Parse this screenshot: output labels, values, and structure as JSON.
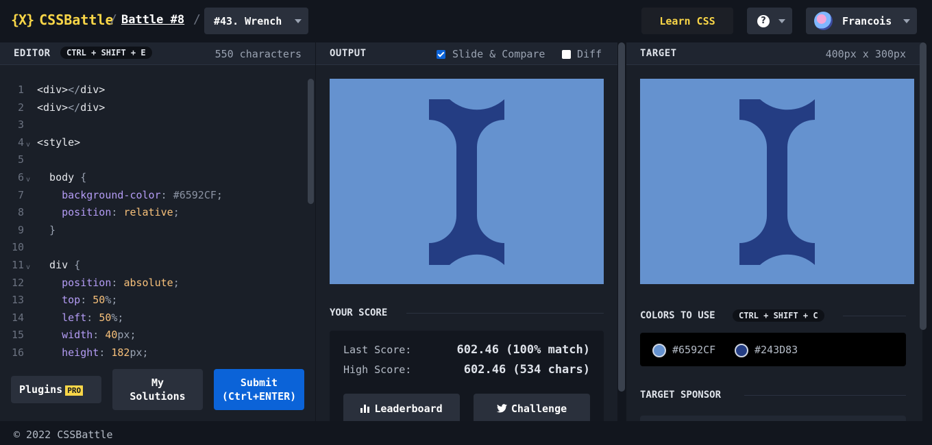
{
  "header": {
    "logo_mark": "{X}",
    "logo_text": "CSSBattle",
    "separator": "/",
    "battle_label": "Battle #8",
    "target_label": "#43. Wrench",
    "learn_label": "Learn CSS",
    "help_symbol": "?",
    "user_name": "Francois"
  },
  "editor": {
    "title": "EDITOR",
    "shortcut": "CTRL + SHIFT + E",
    "char_count": "550 characters",
    "lines": [
      {
        "n": "1",
        "fold": "",
        "parts": [
          [
            "c-tag",
            "<div>"
          ],
          [
            "c-sym",
            "</"
          ],
          [
            "c-tag",
            "div>"
          ]
        ]
      },
      {
        "n": "2",
        "fold": "",
        "parts": [
          [
            "c-tag",
            "<div>"
          ],
          [
            "c-sym",
            "</"
          ],
          [
            "c-tag",
            "div>"
          ]
        ]
      },
      {
        "n": "3",
        "fold": "",
        "parts": []
      },
      {
        "n": "4",
        "fold": "v",
        "parts": [
          [
            "c-tag",
            "<style>"
          ]
        ]
      },
      {
        "n": "5",
        "fold": "",
        "parts": []
      },
      {
        "n": "6",
        "fold": "v",
        "parts": [
          [
            "c-sel",
            "  body "
          ],
          [
            "c-sym",
            "{"
          ]
        ]
      },
      {
        "n": "7",
        "fold": "",
        "parts": [
          [
            "c-prop",
            "    background-color"
          ],
          [
            "c-sym",
            ": "
          ],
          [
            "c-hash",
            "#6592CF"
          ],
          [
            "c-sym",
            ";"
          ]
        ]
      },
      {
        "n": "8",
        "fold": "",
        "parts": [
          [
            "c-prop",
            "    position"
          ],
          [
            "c-sym",
            ": "
          ],
          [
            "c-val",
            "relative"
          ],
          [
            "c-sym",
            ";"
          ]
        ]
      },
      {
        "n": "9",
        "fold": "",
        "parts": [
          [
            "c-sym",
            "  }"
          ]
        ]
      },
      {
        "n": "10",
        "fold": "",
        "parts": []
      },
      {
        "n": "11",
        "fold": "v",
        "parts": [
          [
            "c-sel",
            "  div "
          ],
          [
            "c-sym",
            "{"
          ]
        ]
      },
      {
        "n": "12",
        "fold": "",
        "parts": [
          [
            "c-prop",
            "    position"
          ],
          [
            "c-sym",
            ": "
          ],
          [
            "c-val",
            "absolute"
          ],
          [
            "c-sym",
            ";"
          ]
        ]
      },
      {
        "n": "13",
        "fold": "",
        "parts": [
          [
            "c-prop",
            "    top"
          ],
          [
            "c-sym",
            ": "
          ],
          [
            "c-val",
            "50"
          ],
          [
            "c-sym",
            "%;"
          ]
        ]
      },
      {
        "n": "14",
        "fold": "",
        "parts": [
          [
            "c-prop",
            "    left"
          ],
          [
            "c-sym",
            ": "
          ],
          [
            "c-val",
            "50"
          ],
          [
            "c-sym",
            "%;"
          ]
        ]
      },
      {
        "n": "15",
        "fold": "",
        "parts": [
          [
            "c-prop",
            "    width"
          ],
          [
            "c-sym",
            ": "
          ],
          [
            "c-val",
            "40"
          ],
          [
            "c-sym",
            "px;"
          ]
        ]
      },
      {
        "n": "16",
        "fold": "",
        "parts": [
          [
            "c-prop",
            "    height"
          ],
          [
            "c-sym",
            ": "
          ],
          [
            "c-val",
            "182"
          ],
          [
            "c-sym",
            "px;"
          ]
        ]
      }
    ],
    "plugins_label": "Plugins",
    "pro_badge": "PRO",
    "my_solutions_line1": "My",
    "my_solutions_line2": "Solutions",
    "submit_line1": "Submit",
    "submit_line2": "(Ctrl+ENTER)"
  },
  "output": {
    "title": "OUTPUT",
    "slide_compare_label": "Slide & Compare",
    "slide_compare_checked": true,
    "diff_label": "Diff",
    "diff_checked": false,
    "score_title": "YOUR SCORE",
    "last_score_label": "Last Score:",
    "last_score_value": "602.46 (100% match)",
    "high_score_label": "High Score:",
    "high_score_value": "602.46 (534 chars)",
    "leaderboard_label": "Leaderboard",
    "challenge_label": "Challenge"
  },
  "target": {
    "title": "TARGET",
    "dimensions": "400px x 300px",
    "colors_title": "COLORS TO USE",
    "colors_shortcut": "CTRL + SHIFT + C",
    "colors": [
      "#6592CF",
      "#243D83"
    ],
    "sponsor_title": "TARGET SPONSOR"
  },
  "footer": {
    "copyright": "© 2022 CSSBattle"
  },
  "theme": {
    "background_color": "#6592CF",
    "shape_color": "#243D83",
    "accent_yellow": "#F9D648",
    "submit_blue": "#0B63D8"
  }
}
